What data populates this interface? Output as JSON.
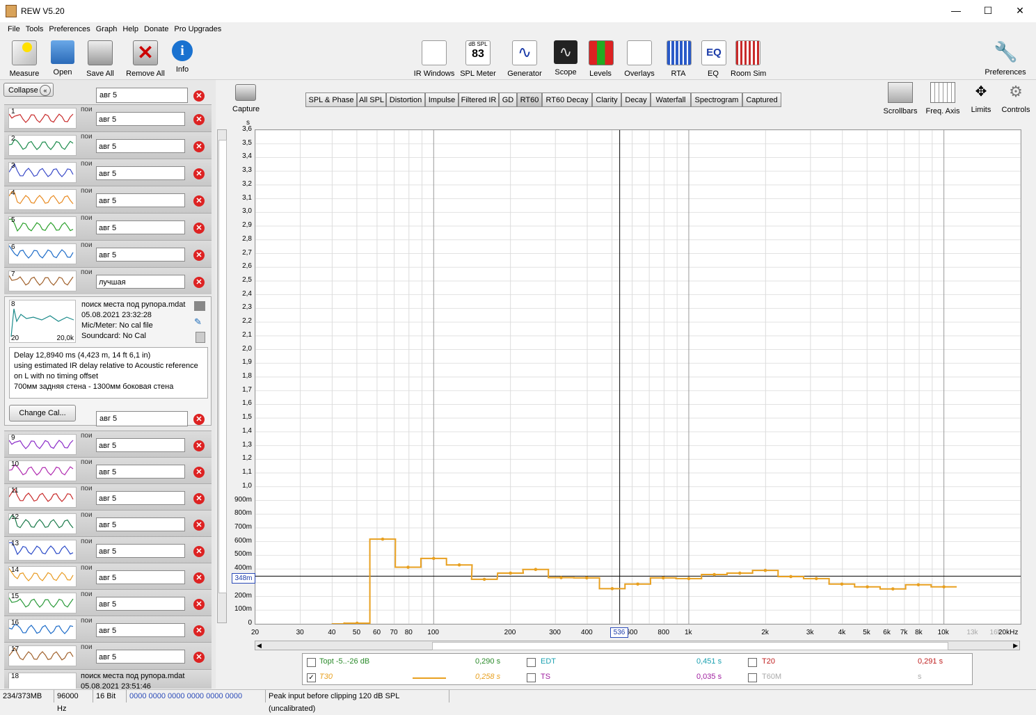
{
  "window": {
    "title": "REW V5.20",
    "minimize": "—",
    "maximize": "☐",
    "close": "✕"
  },
  "menu": [
    "File",
    "Tools",
    "Preferences",
    "Graph",
    "Help",
    "Donate",
    "Pro Upgrades"
  ],
  "toolbar_left": [
    "Measure",
    "Open",
    "Save All",
    "Remove All",
    "Info"
  ],
  "toolbar_center": [
    "IR Windows",
    "SPL Meter",
    "Generator",
    "Scope",
    "Levels",
    "Overlays",
    "RTA",
    "EQ",
    "Room Sim"
  ],
  "spl_meter_badge": {
    "top": "dB SPL",
    "value": "83"
  },
  "toolbar_right": "Preferences",
  "panel": {
    "collapse_label": "Collapse",
    "first_name": "авг 5",
    "measurements": [
      {
        "num": "1",
        "name": "авг 5",
        "side": "пои"
      },
      {
        "num": "2",
        "name": "авг 5",
        "side": "пои"
      },
      {
        "num": "3",
        "name": "авг 5",
        "side": "пои"
      },
      {
        "num": "4",
        "name": "авг 5",
        "side": "пои"
      },
      {
        "num": "5",
        "name": "авг 5",
        "side": "пои"
      },
      {
        "num": "6",
        "name": "авг 5",
        "side": "пои"
      },
      {
        "num": "7",
        "name": "лучшая",
        "side": "пои"
      }
    ],
    "selected": {
      "num": "8",
      "file": "поиск места под рупора.mdat",
      "date": "05.08.2021 23:32:28",
      "mic": "Mic/Meter: No cal file",
      "soundcard": "Soundcard: No Cal",
      "range_lo": "20",
      "range_hi": "20,0k",
      "notes": [
        "Delay 12,8940 ms (4,423 m, 14 ft 6,1 in)",
        "using estimated IR delay relative to Acoustic reference",
        "on  L with no timing offset",
        "700мм задняя стена - 1300мм боковая стена"
      ],
      "change_cal": "Change Cal...",
      "name": "авг 5"
    },
    "measurements2": [
      {
        "num": "9",
        "name": "авг 5",
        "side": "пои"
      },
      {
        "num": "10",
        "name": "авг 5",
        "side": "пои"
      },
      {
        "num": "11",
        "name": "авг 5",
        "side": "пои"
      },
      {
        "num": "12",
        "name": "авг 5",
        "side": "пои"
      },
      {
        "num": "13",
        "name": "авг 5",
        "side": "пои"
      },
      {
        "num": "14",
        "name": "авг 5",
        "side": "пои"
      },
      {
        "num": "15",
        "name": "авг 5",
        "side": "пои"
      },
      {
        "num": "16",
        "name": "авг 5",
        "side": "пои"
      },
      {
        "num": "17",
        "name": "авг 5",
        "side": "пои"
      }
    ],
    "last": {
      "num": "18",
      "file": "поиск места под рупора.mdat",
      "date": "05.08.2021 23:51:46"
    }
  },
  "capture_label": "Capture",
  "tabs": [
    "SPL & Phase",
    "All SPL",
    "Distortion",
    "Impulse",
    "Filtered IR",
    "GD",
    "RT60",
    "RT60 Decay",
    "Clarity",
    "Decay",
    "Waterfall",
    "Spectrogram",
    "Captured"
  ],
  "active_tab": "RT60",
  "right_tools": [
    "Scrollbars",
    "Freq. Axis",
    "Limits",
    "Controls"
  ],
  "cursor": {
    "y_readout": "348m",
    "x_readout": "536"
  },
  "chart_data": {
    "type": "line",
    "ylabel": "s",
    "x_scale": "log",
    "xlim": [
      20,
      20000
    ],
    "ylim": [
      0,
      3.6
    ],
    "y_ticks": [
      "3,6",
      "3,5",
      "3,4",
      "3,3",
      "3,2",
      "3,1",
      "3,0",
      "2,9",
      "2,8",
      "2,7",
      "2,6",
      "2,5",
      "2,4",
      "2,3",
      "2,2",
      "2,1",
      "2,0",
      "1,9",
      "1,8",
      "1,7",
      "1,6",
      "1,5",
      "1,4",
      "1,3",
      "1,2",
      "1,1",
      "1,0",
      "900m",
      "800m",
      "700m",
      "600m",
      "500m",
      "400m",
      "300m",
      "200m",
      "100m",
      "0"
    ],
    "x_ticks": [
      {
        "v": 20,
        "t": "20"
      },
      {
        "v": 30,
        "t": "30"
      },
      {
        "v": 40,
        "t": "40"
      },
      {
        "v": 50,
        "t": "50"
      },
      {
        "v": 60,
        "t": "60"
      },
      {
        "v": 70,
        "t": "70"
      },
      {
        "v": 80,
        "t": "80"
      },
      {
        "v": 100,
        "t": "100"
      },
      {
        "v": 200,
        "t": "200"
      },
      {
        "v": 300,
        "t": "300"
      },
      {
        "v": 400,
        "t": "400"
      },
      {
        "v": 500,
        "t": "5"
      },
      {
        "v": 600,
        "t": "600"
      },
      {
        "v": 800,
        "t": "800"
      },
      {
        "v": 1000,
        "t": "1k"
      },
      {
        "v": 2000,
        "t": "2k"
      },
      {
        "v": 3000,
        "t": "3k"
      },
      {
        "v": 4000,
        "t": "4k"
      },
      {
        "v": 5000,
        "t": "5k"
      },
      {
        "v": 6000,
        "t": "6k"
      },
      {
        "v": 7000,
        "t": "7k"
      },
      {
        "v": 8000,
        "t": "8k"
      },
      {
        "v": 10000,
        "t": "10k"
      },
      {
        "v": 13000,
        "t": "13k",
        "dim": true
      },
      {
        "v": 16000,
        "t": "16k",
        "dim": true
      },
      {
        "v": 20000,
        "t": "20kHz"
      }
    ],
    "series": [
      {
        "name": "T30",
        "color": "#e8a020",
        "bands": [
          {
            "f": 44.7,
            "v": 0.0
          },
          {
            "f": 50.1,
            "v": 0.005
          },
          {
            "f": 63.1,
            "v": 0.618
          },
          {
            "f": 79.4,
            "v": 0.413
          },
          {
            "f": 100,
            "v": 0.477
          },
          {
            "f": 126,
            "v": 0.43
          },
          {
            "f": 158,
            "v": 0.325
          },
          {
            "f": 200,
            "v": 0.37
          },
          {
            "f": 251,
            "v": 0.397
          },
          {
            "f": 316,
            "v": 0.337
          },
          {
            "f": 398,
            "v": 0.335
          },
          {
            "f": 501,
            "v": 0.257
          },
          {
            "f": 631,
            "v": 0.29
          },
          {
            "f": 794,
            "v": 0.335
          },
          {
            "f": 1000,
            "v": 0.33
          },
          {
            "f": 1259,
            "v": 0.36
          },
          {
            "f": 1585,
            "v": 0.37
          },
          {
            "f": 1995,
            "v": 0.39
          },
          {
            "f": 2512,
            "v": 0.345
          },
          {
            "f": 3162,
            "v": 0.33
          },
          {
            "f": 3981,
            "v": 0.29
          },
          {
            "f": 5012,
            "v": 0.27
          },
          {
            "f": 6310,
            "v": 0.255
          },
          {
            "f": 7943,
            "v": 0.285
          },
          {
            "f": 10000,
            "v": 0.27
          }
        ]
      }
    ]
  },
  "legend": [
    {
      "label": "Topt -5..-26 dB",
      "value": "0,290 s",
      "color": "#2a8a2a",
      "checked": false
    },
    {
      "label": "EDT",
      "value": "0,451 s",
      "color": "#1aa0b0",
      "checked": false
    },
    {
      "label": "T20",
      "value": "0,291 s",
      "color": "#c02020",
      "checked": false
    },
    {
      "label": "T30",
      "value": "0,258 s",
      "color": "#e8a020",
      "checked": true
    },
    {
      "label": "TS",
      "value": "0,035 s",
      "color": "#a020a0",
      "checked": false
    },
    {
      "label": "T60M",
      "value": "s",
      "color": "#aaaaaa",
      "checked": false
    }
  ],
  "status": {
    "memory": "234/373MB",
    "rate": "96000 Hz",
    "bits": "16 Bit",
    "timecode": "0000 0000  0000 0000  0000 0000",
    "message": "Peak input before clipping 120 dB SPL (uncalibrated)"
  }
}
